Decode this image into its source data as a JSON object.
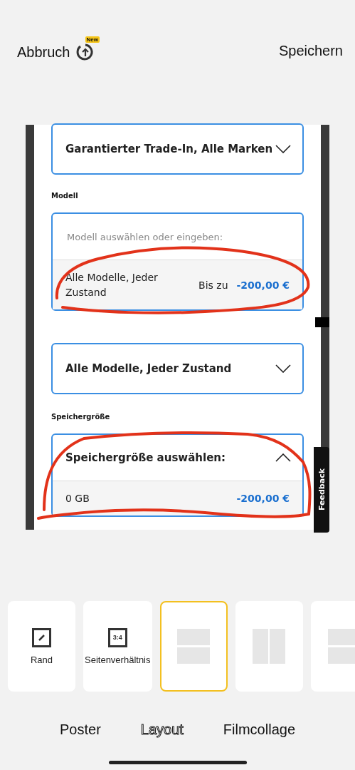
{
  "header": {
    "cancel": "Abbruch",
    "badge": "New",
    "save": "Speichern"
  },
  "preview": {
    "sections": [
      {
        "kind": "select",
        "value": "Garantierter Trade-In, Alle Marken",
        "expanded": false
      },
      {
        "kind": "label",
        "text": "Modell"
      },
      {
        "kind": "combo",
        "placeholder": "Modell auswählen oder eingeben:",
        "options": [
          {
            "name": "Alle Modelle, Jeder Zustand",
            "prefix": "Bis zu",
            "price": "-200,00 €"
          }
        ]
      },
      {
        "kind": "select",
        "value": "Alle Modelle, Jeder Zustand",
        "expanded": false
      },
      {
        "kind": "label",
        "text": "Speichergröße"
      },
      {
        "kind": "select",
        "value": "Speichergröße auswählen:",
        "expanded": true,
        "options": [
          {
            "name": "0 GB",
            "price": "-200,00 €"
          }
        ]
      }
    ],
    "feedback": "Feedback"
  },
  "options": [
    {
      "kind": "border",
      "label": "Rand"
    },
    {
      "kind": "ratio",
      "icon_text": "3:4",
      "label": "Seitenverhältnis"
    },
    {
      "kind": "rows",
      "selected": true
    },
    {
      "kind": "columns",
      "selected": false
    },
    {
      "kind": "rows",
      "selected": false
    }
  ],
  "tabs": [
    {
      "label": "Poster",
      "selected": false
    },
    {
      "label": "Layout",
      "selected": true
    },
    {
      "label": "Filmcollage",
      "selected": false
    }
  ]
}
